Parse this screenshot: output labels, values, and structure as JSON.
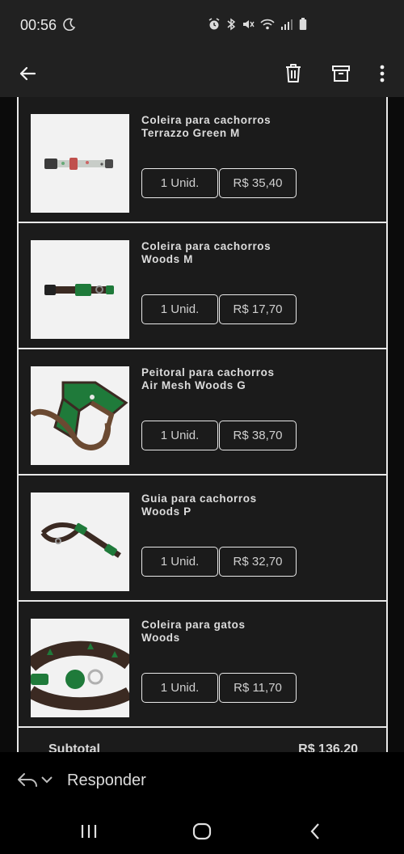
{
  "status_bar": {
    "time": "00:56",
    "icons": [
      "moon-icon",
      "alarm-icon",
      "bluetooth-icon",
      "mute-icon",
      "wifi-icon",
      "signal-icon",
      "battery-icon"
    ]
  },
  "app_bar": {
    "icons": [
      "back-arrow-icon",
      "trash-icon",
      "archive-icon",
      "more-vert-icon"
    ]
  },
  "items": [
    {
      "title_line1": "Coleira para cachorros",
      "title_line2": "Terrazzo Green M",
      "quantity": "1 Unid.",
      "price": "R$ 35,40",
      "image": "collar-terrazzo-image"
    },
    {
      "title_line1": "Coleira para cachorros",
      "title_line2": "Woods M",
      "quantity": "1 Unid.",
      "price": "R$ 17,70",
      "image": "collar-woods-image"
    },
    {
      "title_line1": "Peitoral para cachorros",
      "title_line2": "Air Mesh Woods G",
      "quantity": "1 Unid.",
      "price": "R$ 38,70",
      "image": "harness-woods-image"
    },
    {
      "title_line1": "Guia para cachorros",
      "title_line2": "Woods P",
      "quantity": "1 Unid.",
      "price": "R$ 32,70",
      "image": "leash-woods-image"
    },
    {
      "title_line1": "Coleira para gatos",
      "title_line2": "Woods",
      "quantity": "1 Unid.",
      "price": "R$ 11,70",
      "image": "cat-collar-woods-image"
    }
  ],
  "subtotal": {
    "label": "Subtotal",
    "value": "R$ 136,20"
  },
  "reply_bar": {
    "label": "Responder"
  },
  "nav_bar": {
    "icons": [
      "recents-icon",
      "home-icon",
      "back-icon"
    ]
  },
  "colors": {
    "background": "#1b1b1b",
    "status_bar": "#212121",
    "border": "#e9e9e9",
    "text": "#dcdcdc",
    "thumb_bg": "#f2f2f2",
    "product_green": "#1f7a3a"
  }
}
